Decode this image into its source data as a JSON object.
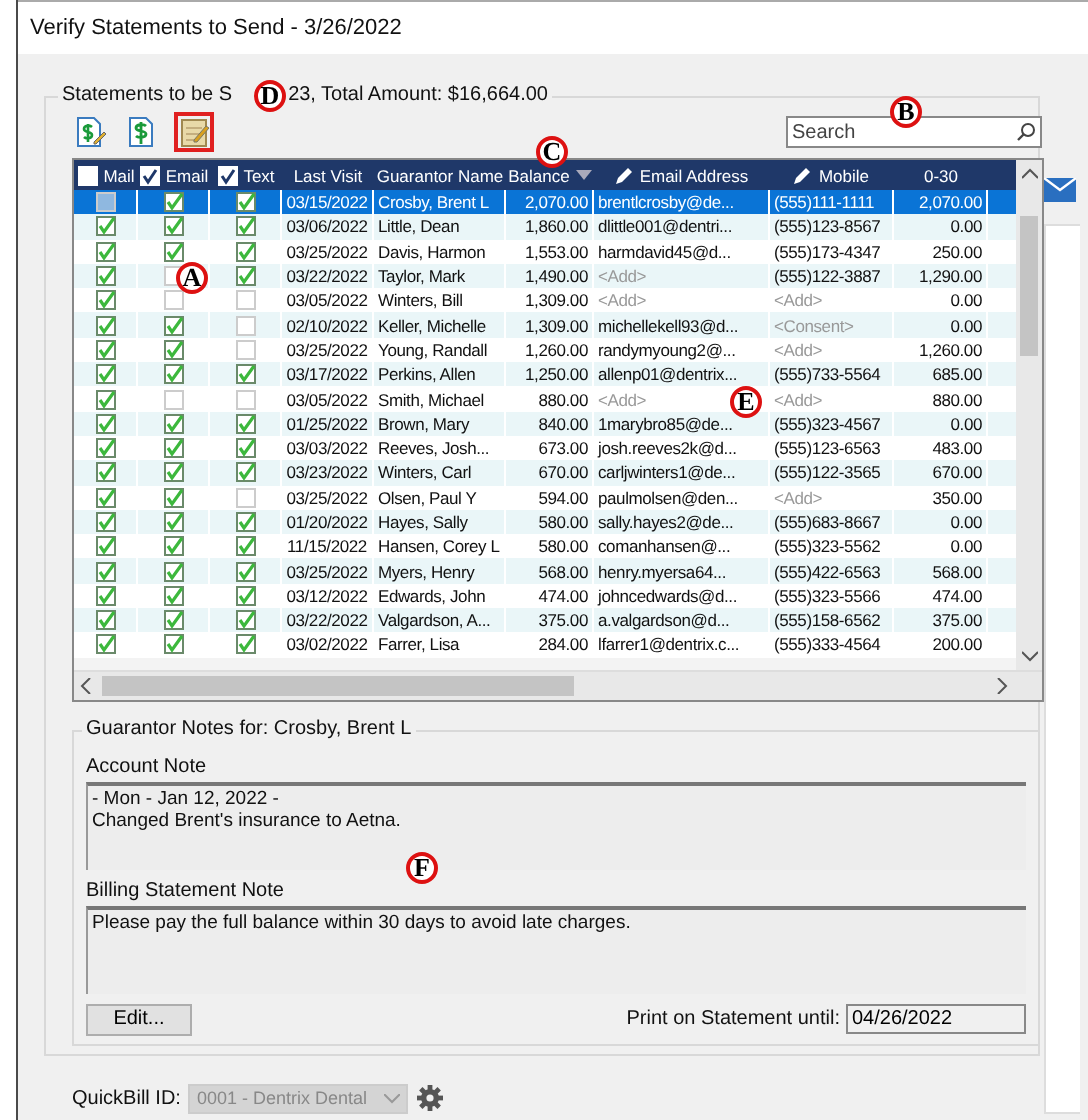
{
  "window": {
    "title": "Verify Statements to Send - 3/26/2022"
  },
  "statements": {
    "legend_start": "Statements to be S",
    "legend_end": "23, Total Amount: $16,664.00"
  },
  "toolbar": [
    {
      "kind": "dollar-edit",
      "highlighted": false
    },
    {
      "kind": "dollar",
      "highlighted": false
    },
    {
      "kind": "note",
      "highlighted": true
    }
  ],
  "search": {
    "placeholder": "Search"
  },
  "columns": [
    {
      "label": "Mail",
      "kind": "checkbox",
      "checked": false,
      "sorted": false
    },
    {
      "label": "Email",
      "kind": "checkbox",
      "checked": true,
      "sorted": false
    },
    {
      "label": "Text",
      "kind": "checkbox",
      "checked": true,
      "sorted": false
    },
    {
      "label": "Last Visit",
      "kind": "text",
      "sorted": false
    },
    {
      "label": "Guarantor Name",
      "kind": "text",
      "sorted": false
    },
    {
      "label": "Balance",
      "kind": "text",
      "sorted": true
    },
    {
      "label": "Email Address",
      "kind": "edit",
      "sorted": false
    },
    {
      "label": "Mobile",
      "kind": "edit",
      "sorted": false
    },
    {
      "label": "0-30",
      "kind": "text",
      "sorted": false
    }
  ],
  "rows": [
    {
      "selected": true,
      "mail": false,
      "email": true,
      "text": true,
      "last_visit": "03/15/2022",
      "name": "Crosby, Brent L",
      "balance": "2,070.00",
      "email_address": "brentlcrosby@de...",
      "mobile": "(555)111-1111",
      "age_0_30": "2,070.00"
    },
    {
      "selected": false,
      "mail": true,
      "email": true,
      "text": true,
      "last_visit": "03/06/2022",
      "name": "Little, Dean",
      "balance": "1,860.00",
      "email_address": "dlittle001@dentri...",
      "mobile": "(555)123-8567",
      "age_0_30": "0.00"
    },
    {
      "selected": false,
      "mail": true,
      "email": true,
      "text": true,
      "last_visit": "03/25/2022",
      "name": "Davis, Harmon",
      "balance": "1,553.00",
      "email_address": "harmdavid45@d...",
      "mobile": "(555)173-4347",
      "age_0_30": "250.00"
    },
    {
      "selected": false,
      "mail": true,
      "email": false,
      "text": true,
      "last_visit": "03/22/2022",
      "name": "Taylor, Mark",
      "balance": "1,490.00",
      "email_address": "<Add>",
      "mobile": "(555)122-3887",
      "age_0_30": "1,290.00"
    },
    {
      "selected": false,
      "mail": true,
      "email": false,
      "text": false,
      "last_visit": "03/05/2022",
      "name": "Winters, Bill",
      "balance": "1,309.00",
      "email_address": "<Add>",
      "mobile": "<Add>",
      "age_0_30": "0.00"
    },
    {
      "selected": false,
      "mail": true,
      "email": true,
      "text": false,
      "last_visit": "02/10/2022",
      "name": "Keller, Michelle",
      "balance": "1,309.00",
      "email_address": "michellekell93@d...",
      "mobile": "<Consent>",
      "age_0_30": "0.00"
    },
    {
      "selected": false,
      "mail": true,
      "email": true,
      "text": false,
      "last_visit": "03/25/2022",
      "name": "Young, Randall",
      "balance": "1,260.00",
      "email_address": "randymyoung2@...",
      "mobile": "<Add>",
      "age_0_30": "1,260.00"
    },
    {
      "selected": false,
      "mail": true,
      "email": true,
      "text": true,
      "last_visit": "03/17/2022",
      "name": "Perkins, Allen",
      "balance": "1,250.00",
      "email_address": "allenp01@dentrix...",
      "mobile": "(555)733-5564",
      "age_0_30": "685.00"
    },
    {
      "selected": false,
      "mail": true,
      "email": false,
      "text": false,
      "last_visit": "03/05/2022",
      "name": "Smith, Michael",
      "balance": "880.00",
      "email_address": "<Add>",
      "mobile": "<Add>",
      "age_0_30": "880.00"
    },
    {
      "selected": false,
      "mail": true,
      "email": true,
      "text": true,
      "last_visit": "01/25/2022",
      "name": "Brown, Mary",
      "balance": "840.00",
      "email_address": "1marybro85@de...",
      "mobile": "(555)323-4567",
      "age_0_30": "0.00"
    },
    {
      "selected": false,
      "mail": true,
      "email": true,
      "text": true,
      "last_visit": "03/03/2022",
      "name": "Reeves, Josh...",
      "balance": "673.00",
      "email_address": "josh.reeves2k@d...",
      "mobile": "(555)123-6563",
      "age_0_30": "483.00"
    },
    {
      "selected": false,
      "mail": true,
      "email": true,
      "text": true,
      "last_visit": "03/23/2022",
      "name": "Winters, Carl",
      "balance": "670.00",
      "email_address": "carljwinters1@de...",
      "mobile": "(555)122-3565",
      "age_0_30": "670.00"
    },
    {
      "selected": false,
      "mail": true,
      "email": true,
      "text": false,
      "last_visit": "03/25/2022",
      "name": "Olsen, Paul Y",
      "balance": "594.00",
      "email_address": "paulmolsen@den...",
      "mobile": "<Add>",
      "age_0_30": "350.00"
    },
    {
      "selected": false,
      "mail": true,
      "email": true,
      "text": true,
      "last_visit": "01/20/2022",
      "name": "Hayes, Sally",
      "balance": "580.00",
      "email_address": "sally.hayes2@de...",
      "mobile": "(555)683-8667",
      "age_0_30": "0.00"
    },
    {
      "selected": false,
      "mail": true,
      "email": true,
      "text": true,
      "last_visit": "11/15/2022",
      "name": "Hansen, Corey L",
      "balance": "580.00",
      "email_address": "comanhansen@...",
      "mobile": "(555)323-5562",
      "age_0_30": "0.00"
    },
    {
      "selected": false,
      "mail": true,
      "email": true,
      "text": true,
      "last_visit": "03/25/2022",
      "name": "Myers, Henry",
      "balance": "568.00",
      "email_address": "henry.myersa64...",
      "mobile": "(555)422-6563",
      "age_0_30": "568.00"
    },
    {
      "selected": false,
      "mail": true,
      "email": true,
      "text": true,
      "last_visit": "03/12/2022",
      "name": "Edwards, John",
      "balance": "474.00",
      "email_address": "johncedwards@d...",
      "mobile": "(555)323-5566",
      "age_0_30": "474.00"
    },
    {
      "selected": false,
      "mail": true,
      "email": true,
      "text": true,
      "last_visit": "03/22/2022",
      "name": "Valgardson, A...",
      "balance": "375.00",
      "email_address": "a.valgardson@d...",
      "mobile": "(555)158-6562",
      "age_0_30": "375.00"
    },
    {
      "selected": false,
      "mail": true,
      "email": true,
      "text": true,
      "last_visit": "03/02/2022",
      "name": "Farrer, Lisa",
      "balance": "284.00",
      "email_address": "lfarrer1@dentrix.c...",
      "mobile": "(555)333-4564",
      "age_0_30": "200.00"
    }
  ],
  "notes": {
    "legend": "Guarantor Notes for: Crosby, Brent L",
    "account_label": "Account Note",
    "account_text": "- Mon - Jan 12, 2022 -\nChanged Brent's insurance to Aetna.",
    "billing_label": "Billing Statement Note",
    "billing_text": "Please pay the full balance within 30 days to avoid late charges.",
    "edit_button": "Edit...",
    "print_label": "Print on Statement until:",
    "print_value": "04/26/2022"
  },
  "quickbill": {
    "label": "QuickBill ID:",
    "value": "0001 - Dentrix Dental",
    "disabled": true
  },
  "callouts": [
    {
      "letter": "A"
    },
    {
      "letter": "B"
    },
    {
      "letter": "C"
    },
    {
      "letter": "D"
    },
    {
      "letter": "E"
    },
    {
      "letter": "F"
    }
  ]
}
